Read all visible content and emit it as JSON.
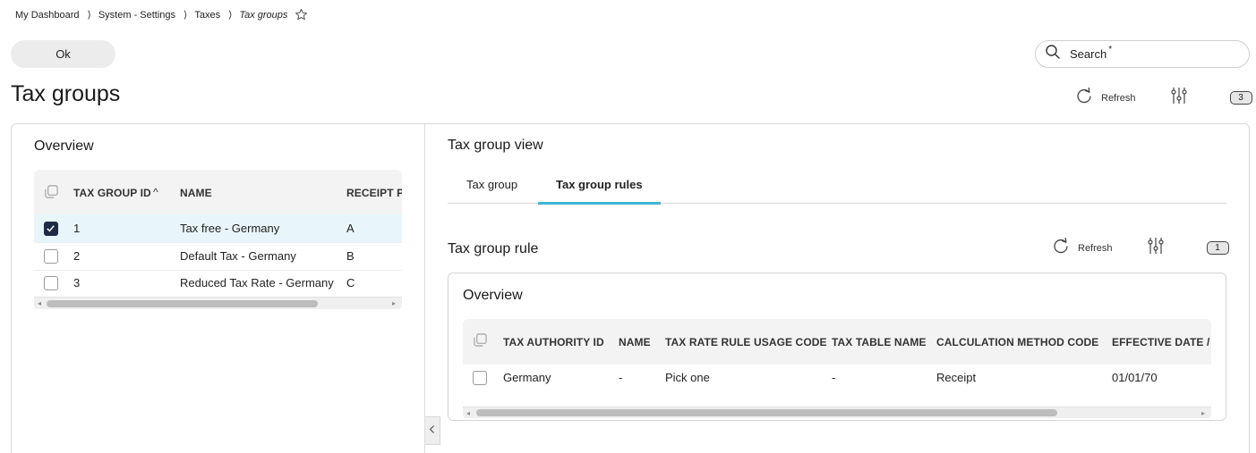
{
  "breadcrumb": [
    {
      "label": "My Dashboard"
    },
    {
      "label": "System - Settings"
    },
    {
      "label": "Taxes"
    },
    {
      "label": "Tax groups"
    }
  ],
  "breadcrumb_separator": "⟩",
  "ok_label": "Ok",
  "search": {
    "label": "Search",
    "asterisk": "*"
  },
  "page_title": "Tax groups",
  "toolbar": {
    "refresh_label": "Refresh",
    "count": "3"
  },
  "left_panel": {
    "title": "Overview",
    "columns": [
      "TAX GROUP ID",
      "NAME",
      "RECEIPT P"
    ],
    "sort_indicator": "^",
    "rows": [
      {
        "id": "1",
        "name": "Tax free - Germany",
        "receipt": "A",
        "checked": true
      },
      {
        "id": "2",
        "name": "Default Tax - Germany",
        "receipt": "B",
        "checked": false
      },
      {
        "id": "3",
        "name": "Reduced Tax Rate - Germany",
        "receipt": "C",
        "checked": false
      }
    ]
  },
  "right_panel": {
    "title": "Tax group view",
    "tabs": [
      {
        "label": "Tax group",
        "active": false
      },
      {
        "label": "Tax group rules",
        "active": true
      }
    ],
    "rule_section": {
      "title": "Tax group rule",
      "refresh_label": "Refresh",
      "count": "1",
      "overview_title": "Overview",
      "columns": [
        "TAX AUTHORITY ID",
        "NAME",
        "TAX RATE RULE USAGE CODE",
        "TAX TABLE NAME",
        "CALCULATION METHOD CODE",
        "EFFECTIVE DATE / T"
      ],
      "rows": [
        {
          "authority": "Germany",
          "name": "-",
          "usage_code": "Pick one",
          "table_name": "-",
          "calc_method": "Receipt",
          "effective_date": "01/01/70",
          "checked": false
        }
      ]
    }
  },
  "colors": {
    "accent": "#3fb6d6",
    "selected_row": "#e8f6fb",
    "checkbox_checked": "#1f2a44"
  },
  "icons": [
    "star-icon",
    "search-icon",
    "refresh-icon",
    "settings-sliders-icon",
    "select-all-icon",
    "chevron-left-icon"
  ]
}
